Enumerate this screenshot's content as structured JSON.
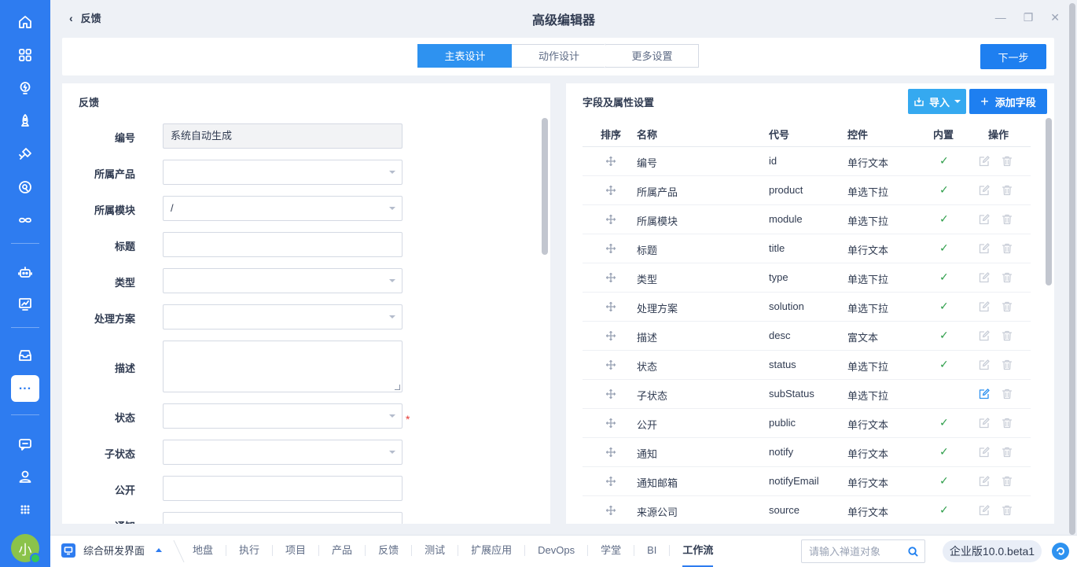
{
  "window": {
    "back_label": "反馈",
    "title": "高级编辑器"
  },
  "steps": [
    "主表设计",
    "动作设计",
    "更多设置"
  ],
  "active_step": 0,
  "next_button": "下一步",
  "form": {
    "title": "反馈",
    "fields": [
      {
        "label": "编号",
        "type": "readonly",
        "value": "系统自动生成"
      },
      {
        "label": "所属产品",
        "type": "select",
        "value": ""
      },
      {
        "label": "所属模块",
        "type": "select",
        "value": "/"
      },
      {
        "label": "标题",
        "type": "text",
        "value": ""
      },
      {
        "label": "类型",
        "type": "select",
        "value": ""
      },
      {
        "label": "处理方案",
        "type": "select",
        "value": ""
      },
      {
        "label": "描述",
        "type": "textarea",
        "value": ""
      },
      {
        "label": "状态",
        "type": "select",
        "value": "",
        "required": true
      },
      {
        "label": "子状态",
        "type": "select",
        "value": ""
      },
      {
        "label": "公开",
        "type": "text",
        "value": ""
      },
      {
        "label": "通知",
        "type": "text",
        "value": ""
      }
    ]
  },
  "fields_panel": {
    "title": "字段及属性设置",
    "import_label": "导入",
    "add_label": "添加字段",
    "columns": [
      "排序",
      "名称",
      "代号",
      "控件",
      "内置",
      "操作"
    ],
    "rows": [
      {
        "name": "编号",
        "code": "id",
        "control": "单行文本",
        "builtin": true,
        "editable": false
      },
      {
        "name": "所属产品",
        "code": "product",
        "control": "单选下拉",
        "builtin": true,
        "editable": false
      },
      {
        "name": "所属模块",
        "code": "module",
        "control": "单选下拉",
        "builtin": true,
        "editable": false
      },
      {
        "name": "标题",
        "code": "title",
        "control": "单行文本",
        "builtin": true,
        "editable": false
      },
      {
        "name": "类型",
        "code": "type",
        "control": "单选下拉",
        "builtin": true,
        "editable": false
      },
      {
        "name": "处理方案",
        "code": "solution",
        "control": "单选下拉",
        "builtin": true,
        "editable": false
      },
      {
        "name": "描述",
        "code": "desc",
        "control": "富文本",
        "builtin": true,
        "editable": false
      },
      {
        "name": "状态",
        "code": "status",
        "control": "单选下拉",
        "builtin": true,
        "editable": false
      },
      {
        "name": "子状态",
        "code": "subStatus",
        "control": "单选下拉",
        "builtin": false,
        "editable": true
      },
      {
        "name": "公开",
        "code": "public",
        "control": "单行文本",
        "builtin": true,
        "editable": false
      },
      {
        "name": "通知",
        "code": "notify",
        "control": "单行文本",
        "builtin": true,
        "editable": false
      },
      {
        "name": "通知邮箱",
        "code": "notifyEmail",
        "control": "单行文本",
        "builtin": true,
        "editable": false
      },
      {
        "name": "来源公司",
        "code": "source",
        "control": "单行文本",
        "builtin": true,
        "editable": false
      }
    ]
  },
  "bottom": {
    "app_name": "综合研发界面",
    "nav": [
      "地盘",
      "执行",
      "项目",
      "产品",
      "反馈",
      "测试",
      "扩展应用",
      "DevOps",
      "学堂",
      "BI",
      "工作流"
    ],
    "active_nav": "工作流",
    "search_placeholder": "请输入禅道对象",
    "version": "企业版10.0.beta1"
  },
  "user": {
    "avatar_text": "小"
  },
  "rail_icons": [
    "home-icon",
    "apps-grid-icon",
    "lightbulb-icon",
    "rocket-icon",
    "satellite-icon",
    "search-circle-icon",
    "infinity-icon",
    "robot-icon",
    "chart-board-icon",
    "inbox-icon",
    "more-icon",
    "chat-icon",
    "user-icon",
    "grid-dots-icon"
  ],
  "colors": {
    "rail": "#2e7cf0",
    "primary": "#1e7ff0",
    "step_active": "#2e92f0",
    "check": "#2e9e4a"
  }
}
